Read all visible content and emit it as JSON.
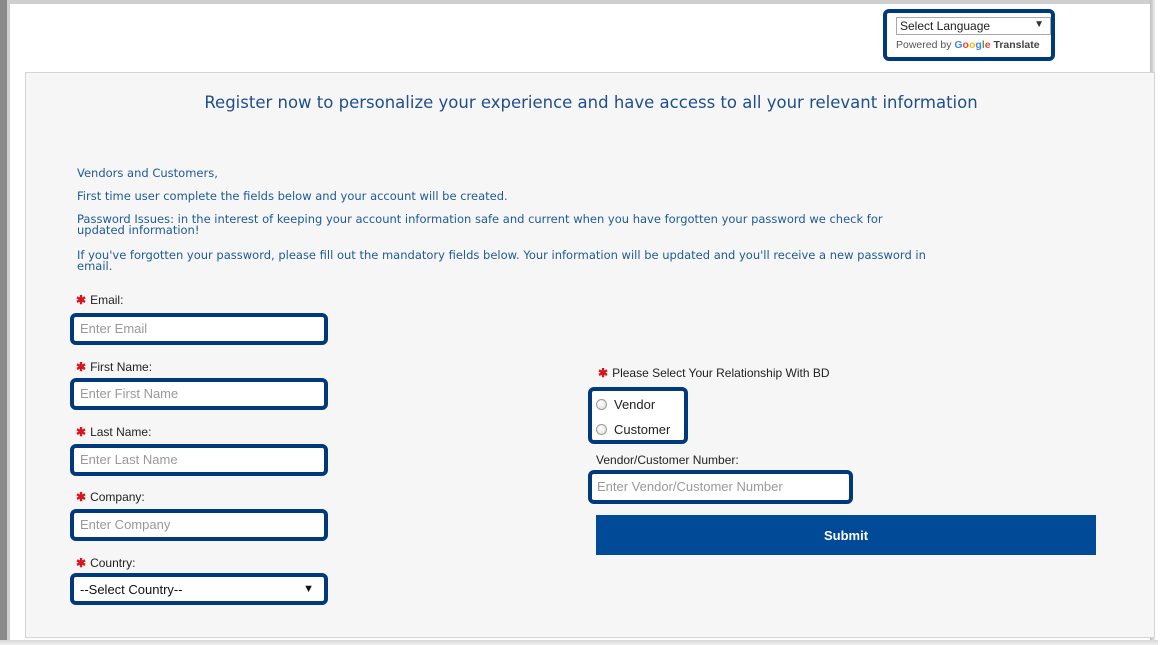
{
  "translate": {
    "select_label": "Select Language",
    "powered_by": "Powered by",
    "google_letters": [
      "G",
      "o",
      "o",
      "g",
      "l",
      "e"
    ],
    "translate_word": "Translate"
  },
  "form": {
    "headline": "Register now to personalize your experience and have access to all your relevant information",
    "intro": {
      "line1": "Vendors and Customers,",
      "line2": "First time user complete the fields below and your account will be created.",
      "line3a": "Password Issues: in the interest of keeping your account information safe and current when you have forgotten your password we check for",
      "line3b": "updated information!",
      "line4a": "If you've forgotten your password, please fill out the mandatory fields below. Your information will be updated and you'll receive a new password in",
      "line4b": "email."
    },
    "required_mark": "✱",
    "email": {
      "label": "Email:",
      "placeholder": "Enter Email"
    },
    "first_name": {
      "label": "First Name:",
      "placeholder": "Enter First Name"
    },
    "last_name": {
      "label": "Last Name:",
      "placeholder": "Enter Last Name"
    },
    "company": {
      "label": "Company:",
      "placeholder": "Enter Company"
    },
    "country": {
      "label": "Country:",
      "selected": "--Select Country--"
    },
    "relationship": {
      "label": "Please Select Your Relationship With BD",
      "options": [
        "Vendor",
        "Customer"
      ]
    },
    "vendor_number": {
      "label": "Vendor/Customer Number:",
      "placeholder": "Enter Vendor/Customer Number"
    },
    "submit_label": "Submit"
  },
  "colors": {
    "highlight_border": "#003a7d",
    "submit_bg": "#004a97",
    "intro_text": "#1f5a96",
    "required": "#d8141e"
  }
}
